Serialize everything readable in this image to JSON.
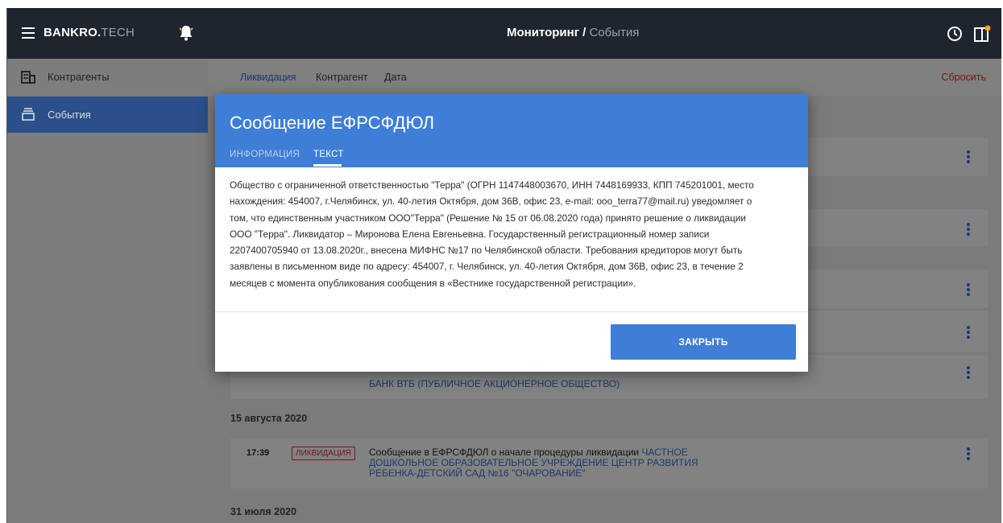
{
  "header": {
    "brand_primary": "BANKRO.",
    "brand_secondary": "TECH",
    "title": "Мониторинг /",
    "title_sub": "События"
  },
  "sidebar": {
    "items": [
      {
        "label": "Контрагенты",
        "icon": "building-icon"
      },
      {
        "label": "События",
        "icon": "inbox-icon",
        "active": true
      }
    ]
  },
  "filters": {
    "items": [
      "Ликвидация",
      "Контрагент",
      "Дата"
    ],
    "reset_label": "Сбросить"
  },
  "feed": {
    "partial_bank_text": "БАНК ВТБ (ПУБЛИЧНОЕ АКЦИОНЕРНОЕ ОБЩЕСТВО)",
    "date1": "15 августа 2020",
    "event1": {
      "time": "17:39",
      "tag": "ЛИКВИДАЦИЯ",
      "text": "Сообщение в ЕФРСФДЮЛ о начале процедуры ликвидации",
      "link": "ЧАСТНОЕ ДОШКОЛЬНОЕ ОБРАЗОВАТЕЛЬНОЕ УЧРЕЖДЕНИЕ ЦЕНТР РАЗВИТИЯ РЕБЕНКА-ДЕТСКИЙ САД №16 \"ОЧАРОВАНИЕ\""
    },
    "date2": "31 июля 2020"
  },
  "modal": {
    "title": "Сообщение ЕФРСФДЮЛ",
    "tabs": [
      "ИНФОРМАЦИЯ",
      "ТЕКСТ"
    ],
    "active_tab": "ТЕКСТ",
    "body_lines": [
      "Общество с ограниченной ответственностью \"Терра\" (ОГРН 1147448003670, ИНН 7448169933, КПП 745201001, место",
      "нахождения: 454007, г.Челябинск, ул. 40-летия Октября, дом 36В, офис 23, e-mail: ooo_terra77@mail.ru) уведомляет о",
      "том, что единственным участником ООО\"Терра\" (Решение № 15 от 06.08.2020 года) принято решение о ликвидации",
      "ООО \"Терра\". Ликвидатор – Миронова Елена Евгеньевна.  Государственный регистрационный номер записи",
      "2207400705940 от 13.08.2020г.,  внесена МИФНС №17 по Челябинской области. Требования кредиторов могут быть",
      "заявлены в письменном виде по адресу: 454007, г. Челябинск, ул. 40-летия Октября, дом 36В, офис 23, в течение 2",
      "месяцев с момента опубликования сообщения в «Вестнике государственной регистрации»."
    ],
    "close_label": "ЗАКРЫТЬ"
  },
  "colors": {
    "topbar": "#1f252f",
    "accent": "#3f7ed6",
    "danger": "#7a1414"
  }
}
